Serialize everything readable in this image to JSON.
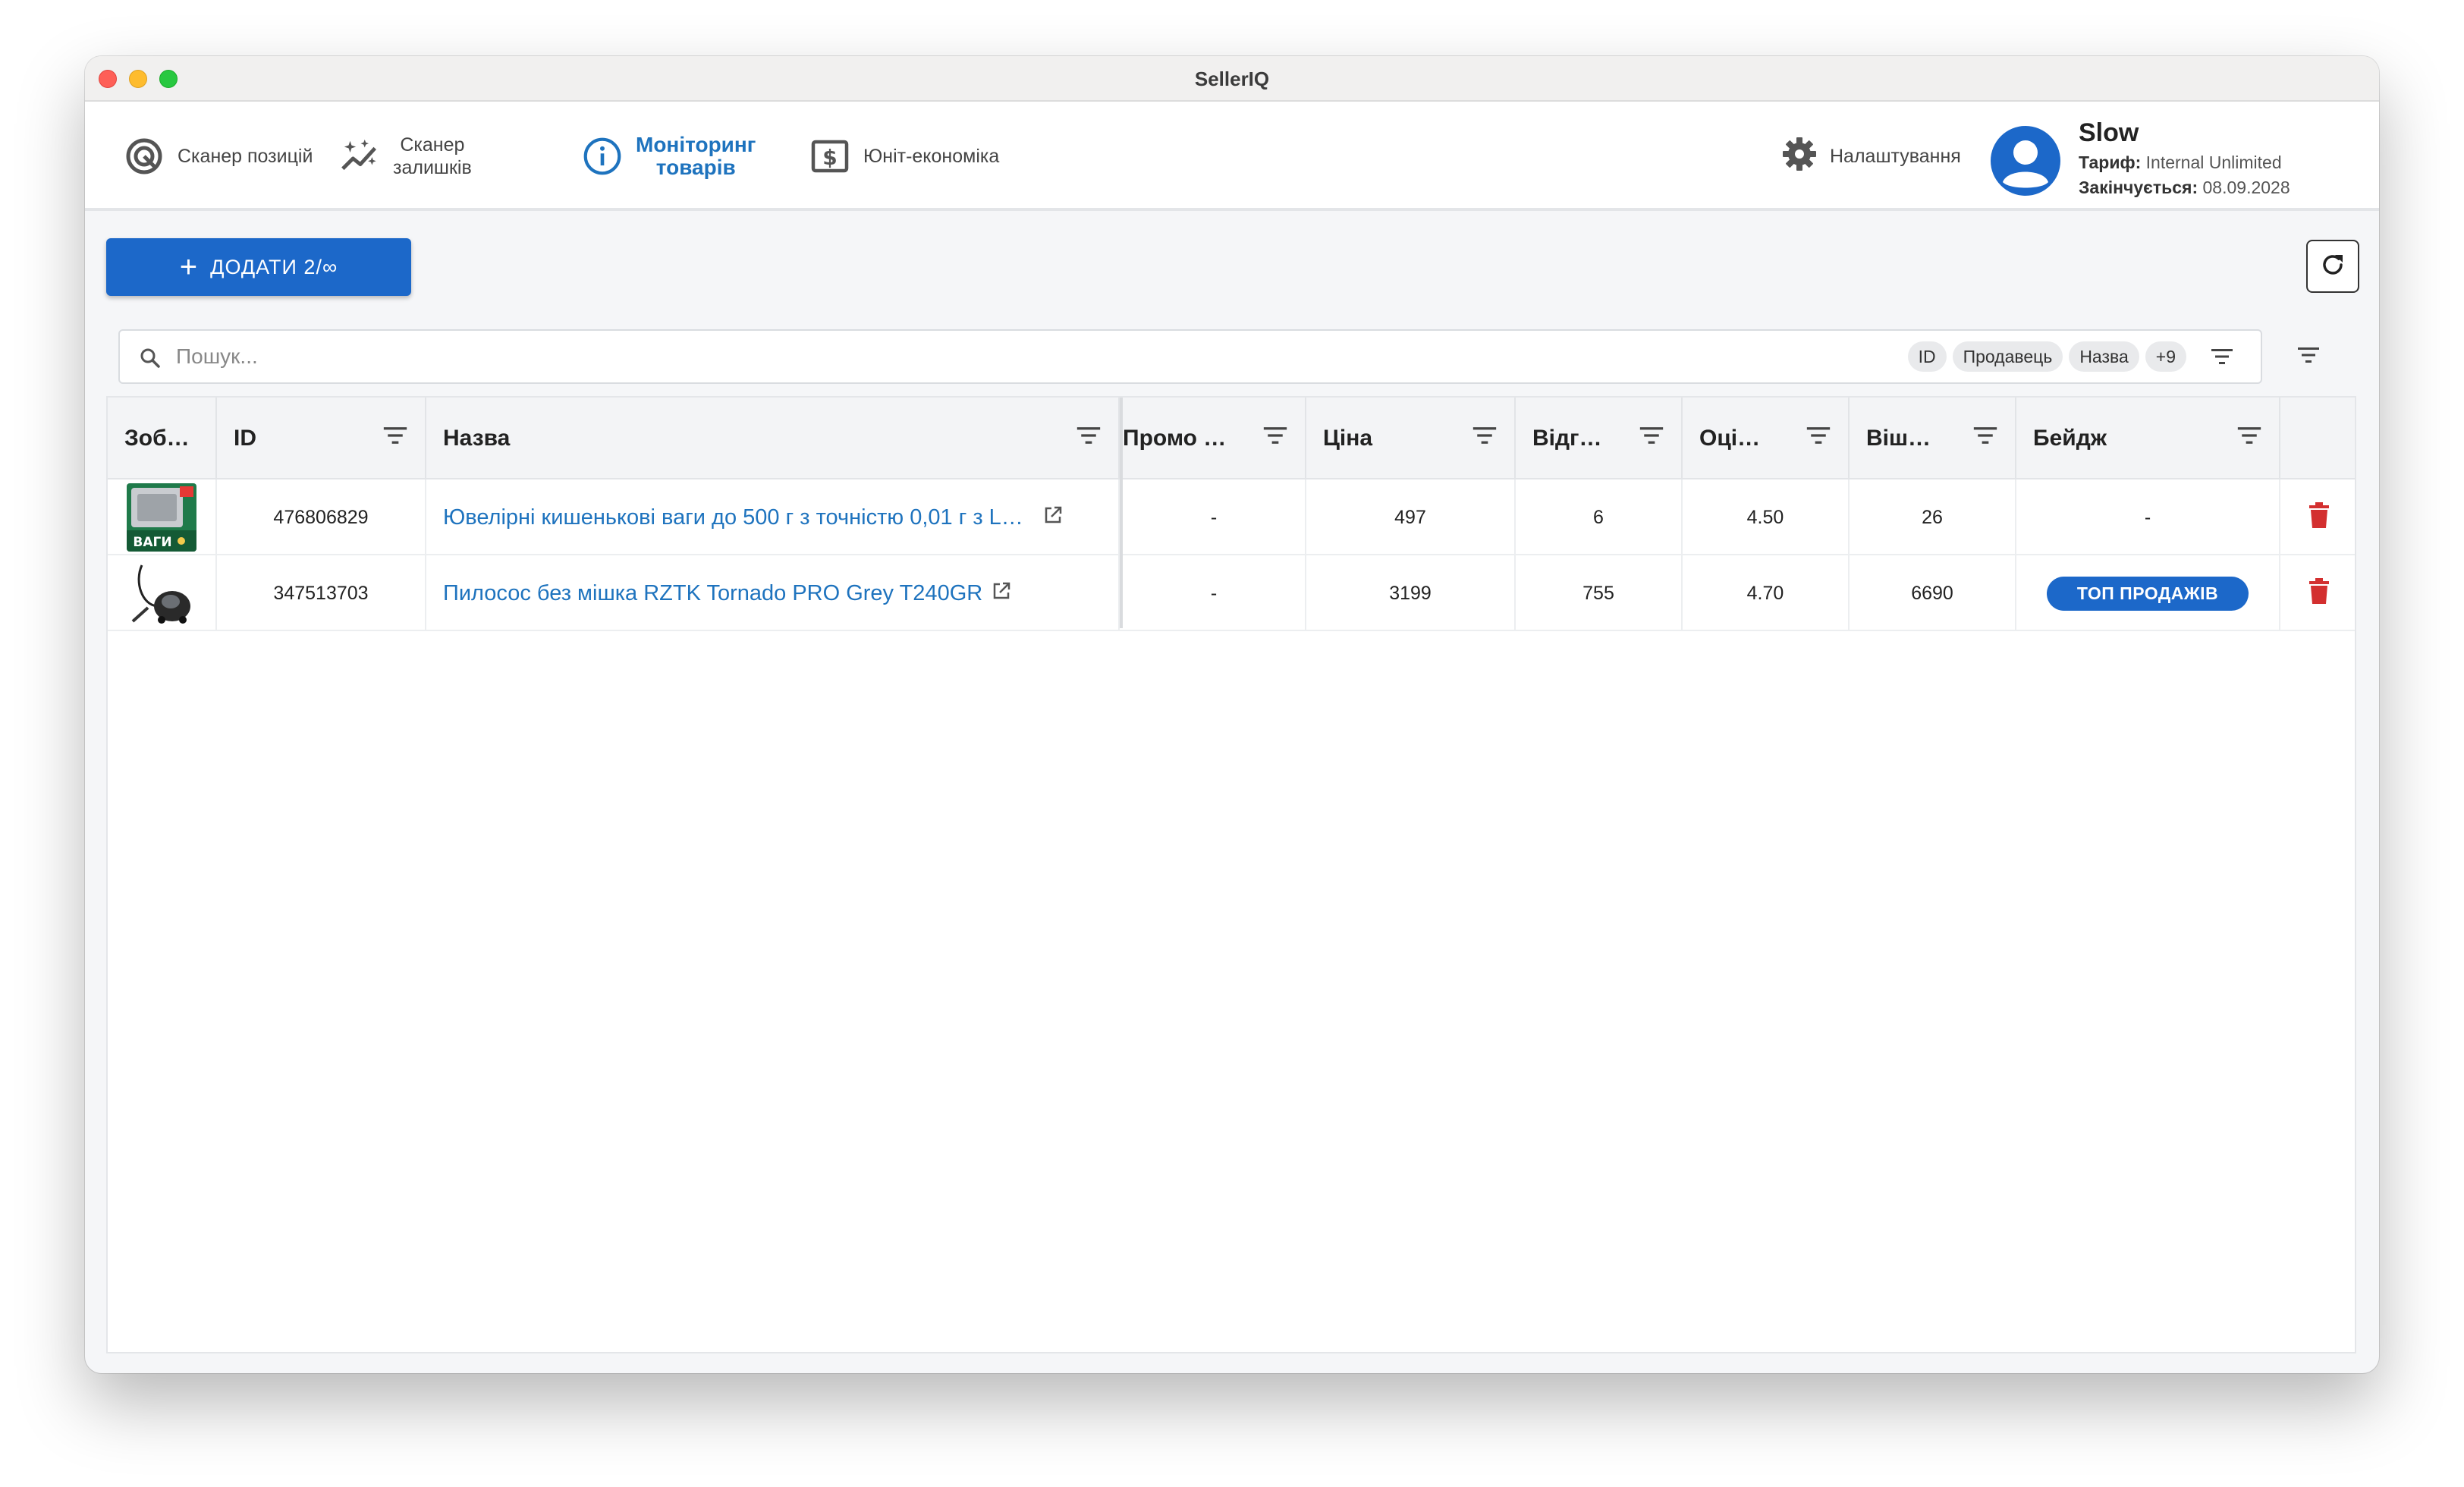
{
  "window": {
    "title": "SellerIQ"
  },
  "nav": {
    "items": [
      {
        "label": "Сканер позицій",
        "icon": "target-icon"
      },
      {
        "label_line1": "Сканер",
        "label_line2": "залишків",
        "icon": "magic-wand-icon"
      },
      {
        "label_line1": "Моніторинг",
        "label_line2": "товарів",
        "icon": "info-icon",
        "active": true
      },
      {
        "label": "Юніт-економіка",
        "icon": "dollar-box-icon"
      }
    ],
    "settings_label": "Налаштування"
  },
  "user": {
    "name": "Slow",
    "plan_label": "Тариф:",
    "plan_value": "Internal Unlimited",
    "expires_label": "Закінчується:",
    "expires_value": "08.09.2028"
  },
  "toolbar": {
    "add_label": "ДОДАТИ 2/∞"
  },
  "search": {
    "placeholder": "Пошук...",
    "chips": [
      "ID",
      "Продавець",
      "Назва",
      "+9"
    ]
  },
  "table": {
    "headers": [
      "Зоб…",
      "ID",
      "Назва",
      "Промо …",
      "Ціна",
      "Відг…",
      "Оці…",
      "Віш…",
      "Бейдж"
    ],
    "rows": [
      {
        "id": "476806829",
        "name": "Ювелірні кишенькові ваги до 500 г з точністю 0,01 г з L…",
        "promo": "-",
        "price": "497",
        "reviews": "6",
        "rating": "4.50",
        "wishlist": "26",
        "badge": "-",
        "thumb_text": "ВАГИ"
      },
      {
        "id": "347513703",
        "name": "Пилосос без мішка RZTK Tornado PRO Grey T240GR",
        "promo": "-",
        "price": "3199",
        "reviews": "755",
        "rating": "4.70",
        "wishlist": "6690",
        "badge": "ТОП ПРОДАЖІВ"
      }
    ]
  },
  "colors": {
    "accent": "#1c68c9",
    "link": "#1e73be",
    "danger": "#d32f2f"
  }
}
